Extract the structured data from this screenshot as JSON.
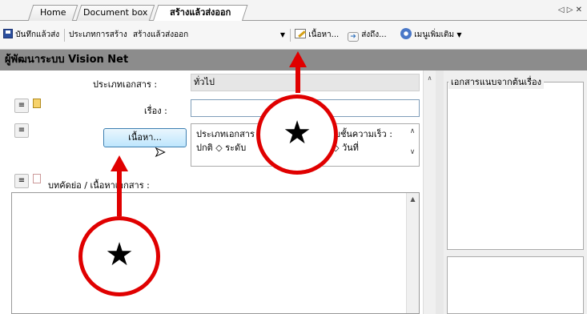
{
  "tabs": [
    {
      "label": "Home"
    },
    {
      "label": "Document box"
    },
    {
      "label": "สร้างแล้วส่งออก"
    }
  ],
  "tab_nav": "◁ ▷ ✕",
  "toolbar": {
    "save_label": "บันทึกแล้วส่ง",
    "doc_type_label": "ประเภทการสร้าง",
    "doc_type_value": "สร้างแล้วส่งออก",
    "content_label": "เนื้อหา...",
    "send_to_label": "ส่งถึง...",
    "more_label": "เมนูเพิ่มเติม"
  },
  "header": {
    "title": "ผู้พัฒนาระบบ Vision Net"
  },
  "form": {
    "doc_type_label": "ประเภทเอกสาร :",
    "doc_type_value": "ทั่วไป",
    "subject_label": "เรื่อง :",
    "subject_value": "",
    "content_button": "เนื้อหา...",
    "content_info_line1": "ประเภทเอกสาร",
    "content_info_line1b": "ระดับชั้นความเร็ว :",
    "content_info_line2": "ปกติ ◇ ระดับ",
    "content_info_line2b": "◇ วันที่",
    "abstract_label": "บทคัดย่อ / เนื้อหาเอกสาร :"
  },
  "right_panel": {
    "attachments_title": "เอกสารแนบจากต้นเรื่อง"
  },
  "annotations": {
    "star_symbol": "★"
  },
  "colors": {
    "annotation_red": "#e00000",
    "header_gray": "#8c8c8c"
  }
}
